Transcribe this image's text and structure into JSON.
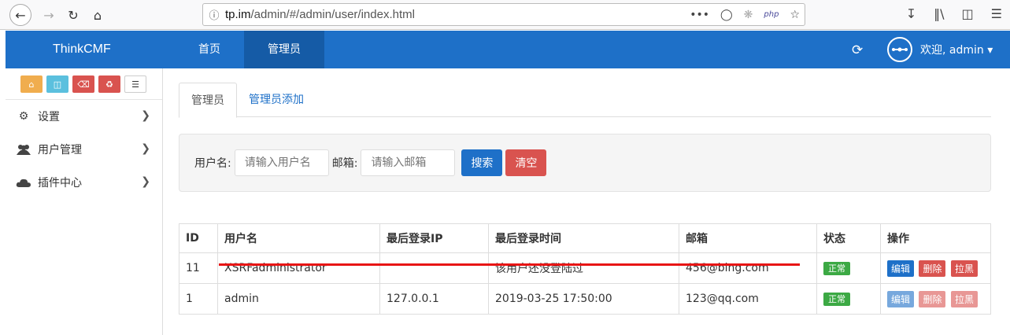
{
  "browser": {
    "url_domain": "tp.im",
    "url_path": "/admin/#/admin/user/index.html",
    "url_menu": "•••",
    "url_badge": "php"
  },
  "header": {
    "brand": "ThinkCMF",
    "nav": [
      "首页",
      "管理员"
    ],
    "welcome": "欢迎, admin"
  },
  "sidebar": {
    "items": [
      {
        "label": "设置",
        "icon": "gears-icon"
      },
      {
        "label": "用户管理",
        "icon": "users-icon"
      },
      {
        "label": "插件中心",
        "icon": "cloud-icon"
      }
    ]
  },
  "main": {
    "tabs": [
      "管理员",
      "管理员添加"
    ],
    "filter": {
      "username_label": "用户名:",
      "username_placeholder": "请输入用户名",
      "email_label": "邮箱:",
      "email_placeholder": "请输入邮箱",
      "search_label": "搜索",
      "clear_label": "清空"
    },
    "table": {
      "headers": [
        "ID",
        "用户名",
        "最后登录IP",
        "最后登录时间",
        "邮箱",
        "状态",
        "操作"
      ],
      "rows": [
        {
          "id": "11",
          "username": "XSRFadministrator",
          "ip": "",
          "time": "该用户还没登陆过",
          "email": "456@bing.com",
          "status": "正常",
          "edit": "编辑",
          "delete": "删除",
          "block": "拉黑"
        },
        {
          "id": "1",
          "username": "admin",
          "ip": "127.0.0.1",
          "time": "2019-03-25 17:50:00",
          "email": "123@qq.com",
          "status": "正常",
          "edit": "编辑",
          "delete": "删除",
          "block": "拉黑"
        }
      ]
    }
  },
  "colors": {
    "brand_blue": "#1e70c8",
    "danger": "#d9534f",
    "success": "#3ca944",
    "annotation_red": "#e81515"
  }
}
